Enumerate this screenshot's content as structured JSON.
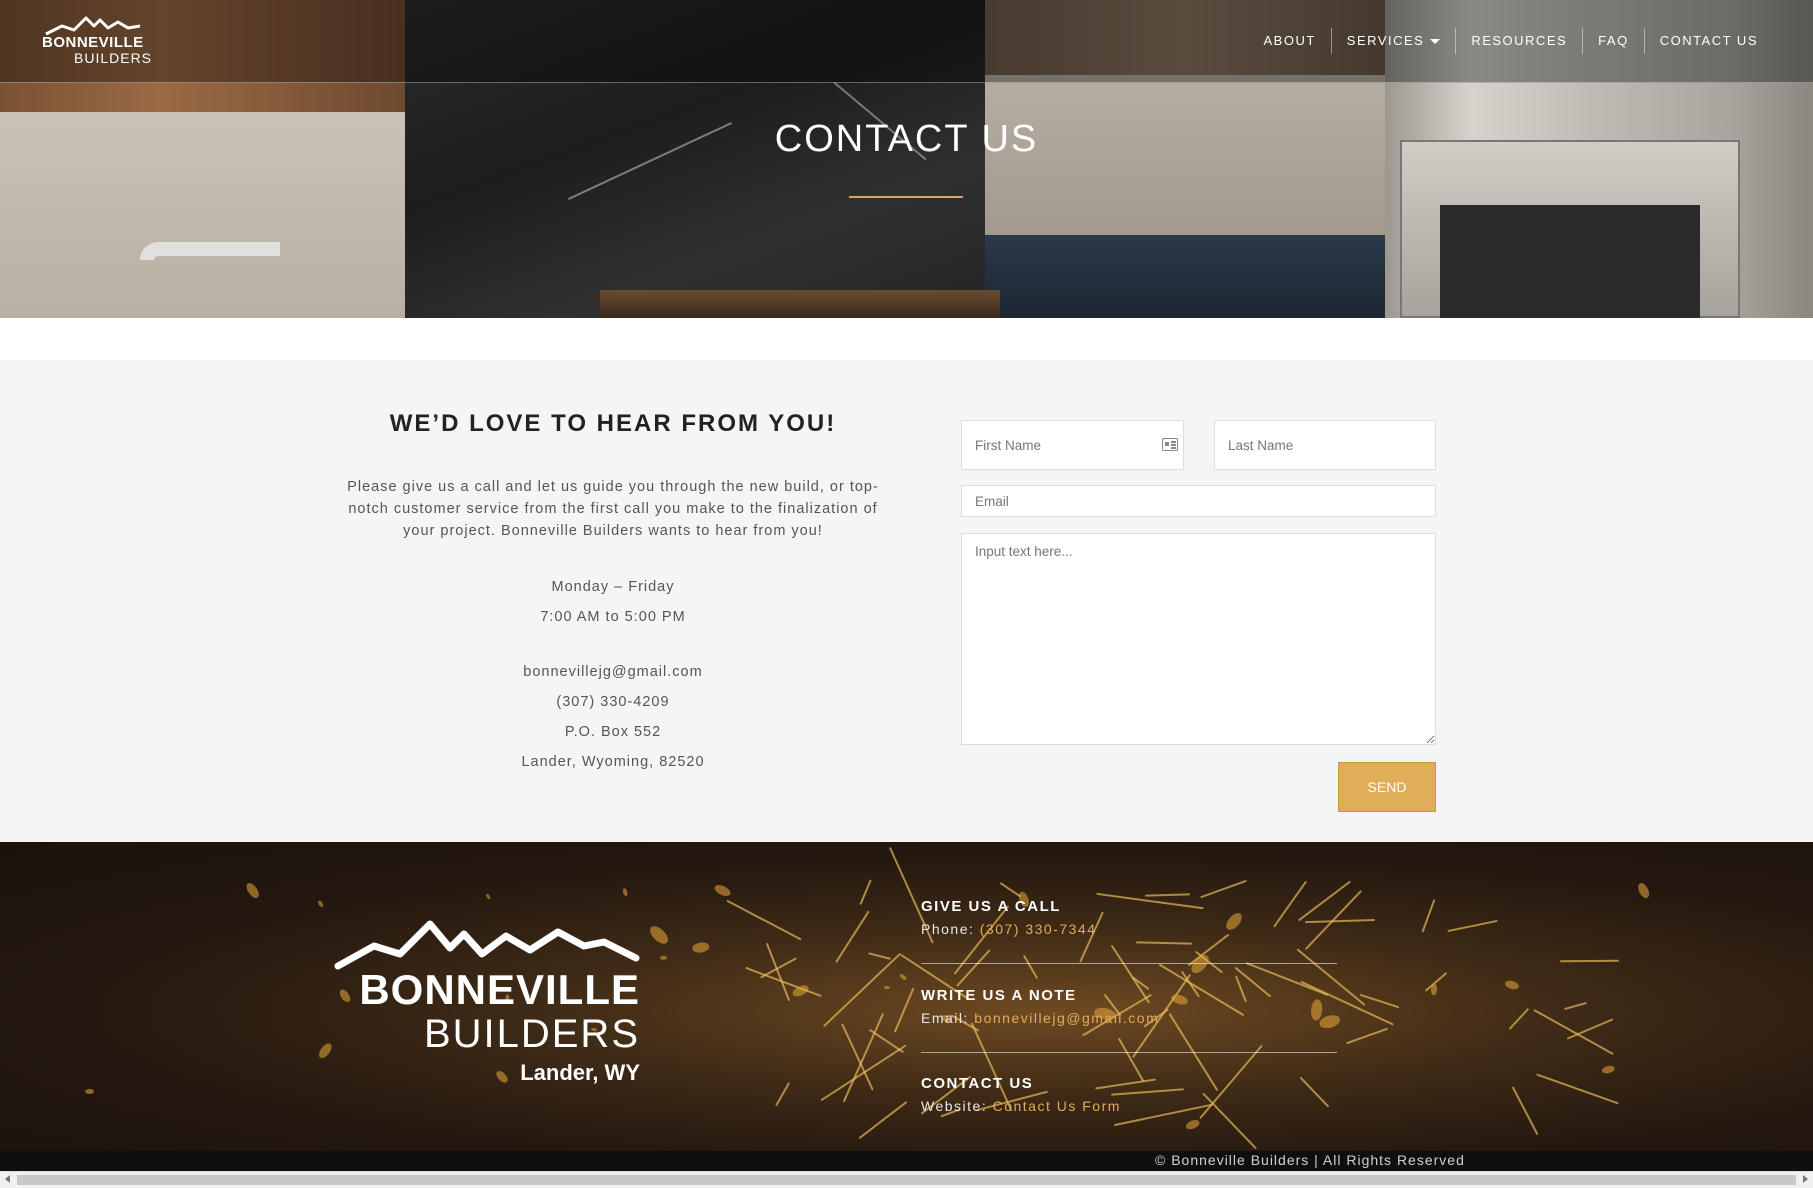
{
  "brand": {
    "logo_line1": "BONNEVILLE",
    "logo_line2": "BUILDERS",
    "location": "Lander, WY"
  },
  "nav": {
    "items": [
      {
        "label": "ABOUT"
      },
      {
        "label": "SERVICES",
        "has_dropdown": true
      },
      {
        "label": "RESOURCES"
      },
      {
        "label": "FAQ"
      },
      {
        "label": "CONTACT US"
      }
    ]
  },
  "hero": {
    "title": "CONTACT US",
    "accent_color": "#d8a95b"
  },
  "intro": {
    "heading": "WE’D LOVE TO HEAR FROM YOU!",
    "text": "Please give us a call and let us guide you through the new build, or top-notch customer service from the first call you make to the finalization of your project. Bonneville Builders wants to hear from you!"
  },
  "hours": {
    "days": "Monday –  Friday",
    "time": "7:00 AM to 5:00 PM"
  },
  "contact_info": {
    "email": "bonnevillejg@gmail.com",
    "phone": "(307) 330-4209",
    "po_box": "P.O. Box 552",
    "city": "Lander, Wyoming, 82520"
  },
  "form": {
    "first_name_placeholder": "First Name",
    "last_name_placeholder": "Last Name",
    "email_placeholder": "Email",
    "message_placeholder": "Input text here...",
    "send_label": "SEND",
    "button_color": "#e0ad58"
  },
  "footer": {
    "call_heading": "GIVE US A CALL",
    "call_prefix": "Phone: ",
    "call_value": "(307) 330-7344",
    "note_heading": "WRITE US A NOTE",
    "note_prefix": "Email: ",
    "note_value": "bonnevillejg@gmail.com",
    "contact_heading": "CONTACT US",
    "contact_prefix": "Website: ",
    "contact_value": "Contact Us Form",
    "copyright": "© Bonneville Builders | All Rights Reserved"
  },
  "icons": {
    "mountain": "mountain-icon",
    "contact_card": "contact-card-icon",
    "dropdown": "caret-down-icon"
  }
}
